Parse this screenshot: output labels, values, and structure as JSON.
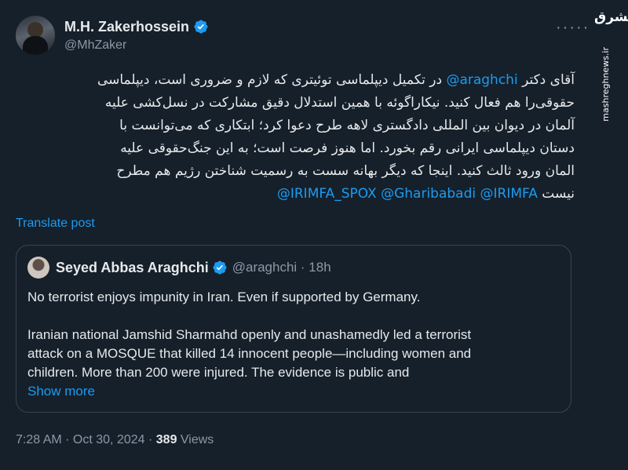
{
  "author": {
    "name": "M.H. Zakerhossein",
    "handle": "@MhZaker"
  },
  "more_label": "·····",
  "watermark": {
    "logo_text": "مشرق",
    "site": "mashreghnews.ir"
  },
  "tweet": {
    "lines": [
      {
        "pre": "آقای دکتر ",
        "mention": "@araghchi",
        "post": " در تکمیل دیپلماسی توئیتری که لازم و ضروری است، دیپلماسی"
      },
      {
        "text": "حقوقی‌را هم فعال کنید. نیکاراگوئه با همین استدلال دقیق مشارکت در نسل‌کشی علیه"
      },
      {
        "text": "آلمان در دیوان بین المللی دادگستری لاهه طرح دعوا کرد؛ ابتکاری که می‌توانست با"
      },
      {
        "text": "دستان دیپلماسی ایرانی رقم بخورد. اما هنوز فرصت است؛ به این جنگ‌حقوقی علیه"
      },
      {
        "text": "المان ورود ثالث کنید. اینجا که دیگر بهانه سست به رسمیت شناختن رژیم هم مطرح"
      },
      {
        "pre": "نیست ",
        "mentions": "@IRIMFA_SPOX @Gharibabadi @IRIMFA"
      }
    ]
  },
  "translate_label": "Translate post",
  "quote": {
    "name": "Seyed Abbas Araghchi",
    "handle_time": "@araghchi · 18h",
    "para1": "No terrorist enjoys impunity in Iran. Even if supported by Germany.",
    "para2_line1": "Iranian national Jamshid Sharmahd openly and unashamedly led a terrorist",
    "para2_line2": "attack on a MOSQUE that killed 14 innocent people—including women and",
    "para2_line3": "children. More than 200 were injured. The evidence is public and",
    "show_more": "Show more"
  },
  "footer": {
    "timestamp": "7:28 AM · Oct 30, 2024 · ",
    "views_count": "389",
    "views_label": " Views"
  },
  "colors": {
    "background": "#15202b",
    "link": "#1d9bf0",
    "muted": "#8b98a5",
    "text": "#e7e9ea"
  },
  "icons": [
    "verified-badge-icon",
    "more-options-icon"
  ]
}
